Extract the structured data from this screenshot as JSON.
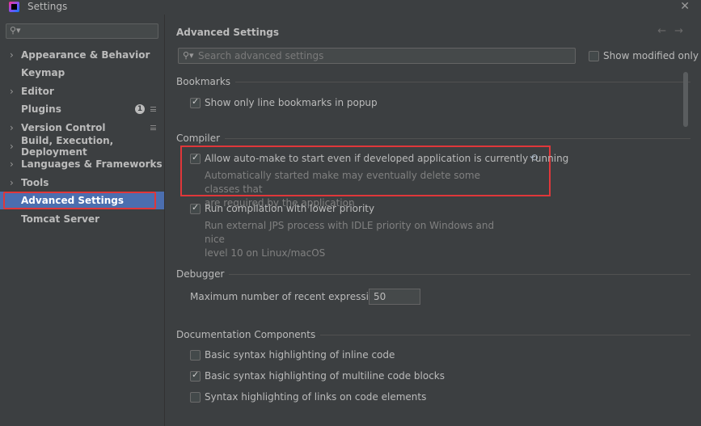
{
  "window": {
    "title": "Settings"
  },
  "sidebar": {
    "search_placeholder": "",
    "items": [
      {
        "label": "Appearance & Behavior",
        "expandable": true
      },
      {
        "label": "Keymap",
        "expandable": false
      },
      {
        "label": "Editor",
        "expandable": true
      },
      {
        "label": "Plugins",
        "expandable": false,
        "badge": "1"
      },
      {
        "label": "Version Control",
        "expandable": true
      },
      {
        "label": "Build, Execution, Deployment",
        "expandable": true
      },
      {
        "label": "Languages & Frameworks",
        "expandable": true
      },
      {
        "label": "Tools",
        "expandable": true
      },
      {
        "label": "Advanced Settings",
        "expandable": false,
        "selected": true
      },
      {
        "label": "Tomcat Server",
        "expandable": false
      }
    ]
  },
  "main": {
    "title": "Advanced Settings",
    "search_placeholder": "Search advanced settings",
    "show_modified_label": "Show modified only",
    "sections": {
      "bookmarks": {
        "title": "Bookmarks",
        "opt1": {
          "label": "Show only line bookmarks in popup",
          "checked": true
        }
      },
      "compiler": {
        "title": "Compiler",
        "opt1": {
          "label": "Allow auto-make to start even if developed application is currently running",
          "checked": true,
          "desc_line1": "Automatically started make may eventually delete some classes that",
          "desc_line2": "are required by the application"
        },
        "opt2": {
          "label": "Run compilation with lower priority",
          "checked": true,
          "desc_line1": "Run external JPS process with IDLE priority on Windows and nice",
          "desc_line2": "level 10 on Linux/macOS"
        }
      },
      "debugger": {
        "title": "Debugger",
        "max_expr_label": "Maximum number of recent expressions:",
        "max_expr_value": "50"
      },
      "docs": {
        "title": "Documentation Components",
        "opt1": {
          "label": "Basic syntax highlighting of inline code",
          "checked": false
        },
        "opt2": {
          "label": "Basic syntax highlighting of multiline code blocks",
          "checked": true
        },
        "opt3": {
          "label": "Syntax highlighting of links on code elements",
          "checked": false
        }
      }
    }
  },
  "colors": {
    "background": "#3c3f41",
    "selection": "#4b6eaf",
    "highlight_border": "#e0373a"
  },
  "icons": {
    "search": "search-icon",
    "close": "close-icon",
    "reset": "reset-icon",
    "back": "arrow-left-icon",
    "forward": "arrow-right-icon"
  }
}
